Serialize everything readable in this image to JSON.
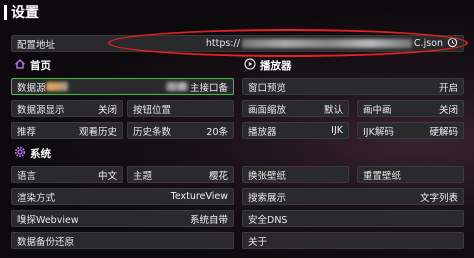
{
  "header": {
    "title": "设置"
  },
  "config": {
    "label": "配置地址",
    "url_prefix": "https://",
    "url_suffix": "C.json"
  },
  "home": {
    "section": "首页",
    "datasource_label": "数据源",
    "datasource_value": "主接口备",
    "datasource_display_label": "数据源显示",
    "datasource_display_value": "关闭",
    "button_position_label": "按钮位置",
    "recommend_label": "推荐",
    "recommend_value": "观看历史",
    "history_count_label": "历史条数",
    "history_count_value": "20条"
  },
  "player": {
    "section": "播放器",
    "preview_label": "窗口预览",
    "preview_value": "开启",
    "scale_label": "画面缩放",
    "scale_value": "默认",
    "pip_label": "画中画",
    "pip_value": "关闭",
    "player_label": "播放器",
    "player_value": "IJK",
    "ijk_decode_label": "IJK解码",
    "ijk_decode_value": "硬解码"
  },
  "system": {
    "section": "系统",
    "language_label": "语言",
    "language_value": "中文",
    "theme_label": "主题",
    "theme_value": "樱花",
    "wallpaper_label": "换张壁纸",
    "reset_wallpaper_label": "重置壁纸",
    "render_label": "渲染方式",
    "render_value": "TextureView",
    "search_display_label": "搜索展示",
    "search_display_value": "文字列表",
    "webview_label": "嗅探Webview",
    "webview_value": "系统自带",
    "dns_label": "安全DNS",
    "backup_label": "数据备份还原",
    "about_label": "关于"
  },
  "colors": {
    "highlight_green": "#3fbf3f",
    "annotation_red": "#e32222"
  }
}
